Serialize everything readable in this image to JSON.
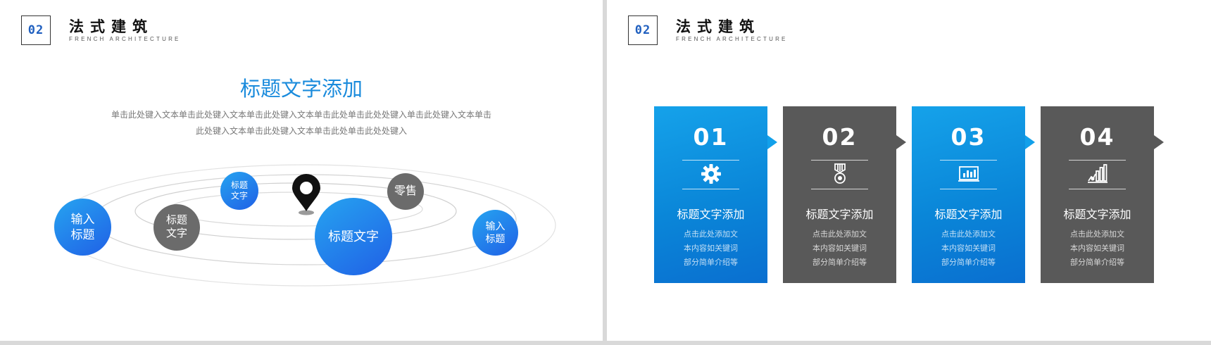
{
  "left_slide": {
    "header": {
      "number": "02",
      "title": "法式建筑",
      "subtitle": "FRENCH ARCHITECTURE"
    },
    "title": "标题文字添加",
    "body_line1": "单击此处键入文本单击此处键入文本单击此处键入文本单击此处单击此处处键入单击此处键入文本单击",
    "body_line2": "此处键入文本单击此处键入文本单击此处单击此处处键入",
    "bubbles": {
      "far_left": [
        "输入",
        "标题"
      ],
      "gray_left": [
        "标题",
        "文字"
      ],
      "small_top": [
        "标题",
        "文字"
      ],
      "center": "标题文字",
      "retail": "零售",
      "right": [
        "输入",
        "标题"
      ]
    },
    "colors": {
      "accent": "#1a8bdc",
      "blue_start": "#26a4f0",
      "blue_end": "#2060e6",
      "gray": "#6b6b6b"
    }
  },
  "right_slide": {
    "header": {
      "number": "02",
      "title": "法式建筑",
      "subtitle": "FRENCH ARCHITECTURE"
    },
    "cards": [
      {
        "number": "01",
        "icon": "gear-icon",
        "title": "标题文字添加",
        "lines": [
          "点击此处添加文",
          "本内容如关键词",
          "部分简单介绍等"
        ],
        "color": "blue"
      },
      {
        "number": "02",
        "icon": "medal-icon",
        "title": "标题文字添加",
        "lines": [
          "点击此处添加文",
          "本内容如关键词",
          "部分简单介绍等"
        ],
        "color": "gray"
      },
      {
        "number": "03",
        "icon": "chart-board-icon",
        "title": "标题文字添加",
        "lines": [
          "点击此处添加文",
          "本内容如关键词",
          "部分简单介绍等"
        ],
        "color": "blue"
      },
      {
        "number": "04",
        "icon": "growth-chart-icon",
        "title": "标题文字添加",
        "lines": [
          "点击此处添加文",
          "本内容如关键词",
          "部分简单介绍等"
        ],
        "color": "gray"
      }
    ]
  }
}
